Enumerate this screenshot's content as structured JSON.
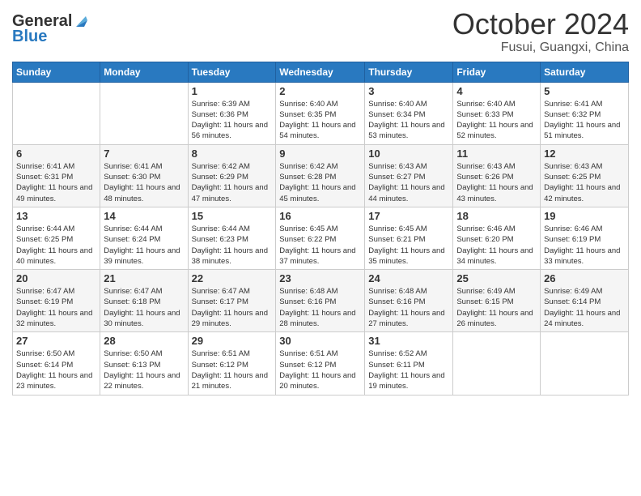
{
  "header": {
    "logo": {
      "general": "General",
      "blue": "Blue"
    },
    "title": "October 2024",
    "location": "Fusui, Guangxi, China"
  },
  "weekdays": [
    "Sunday",
    "Monday",
    "Tuesday",
    "Wednesday",
    "Thursday",
    "Friday",
    "Saturday"
  ],
  "weeks": [
    [
      {
        "day": "",
        "sunrise": "",
        "sunset": "",
        "daylight": ""
      },
      {
        "day": "",
        "sunrise": "",
        "sunset": "",
        "daylight": ""
      },
      {
        "day": "1",
        "sunrise": "Sunrise: 6:39 AM",
        "sunset": "Sunset: 6:36 PM",
        "daylight": "Daylight: 11 hours and 56 minutes."
      },
      {
        "day": "2",
        "sunrise": "Sunrise: 6:40 AM",
        "sunset": "Sunset: 6:35 PM",
        "daylight": "Daylight: 11 hours and 54 minutes."
      },
      {
        "day": "3",
        "sunrise": "Sunrise: 6:40 AM",
        "sunset": "Sunset: 6:34 PM",
        "daylight": "Daylight: 11 hours and 53 minutes."
      },
      {
        "day": "4",
        "sunrise": "Sunrise: 6:40 AM",
        "sunset": "Sunset: 6:33 PM",
        "daylight": "Daylight: 11 hours and 52 minutes."
      },
      {
        "day": "5",
        "sunrise": "Sunrise: 6:41 AM",
        "sunset": "Sunset: 6:32 PM",
        "daylight": "Daylight: 11 hours and 51 minutes."
      }
    ],
    [
      {
        "day": "6",
        "sunrise": "Sunrise: 6:41 AM",
        "sunset": "Sunset: 6:31 PM",
        "daylight": "Daylight: 11 hours and 49 minutes."
      },
      {
        "day": "7",
        "sunrise": "Sunrise: 6:41 AM",
        "sunset": "Sunset: 6:30 PM",
        "daylight": "Daylight: 11 hours and 48 minutes."
      },
      {
        "day": "8",
        "sunrise": "Sunrise: 6:42 AM",
        "sunset": "Sunset: 6:29 PM",
        "daylight": "Daylight: 11 hours and 47 minutes."
      },
      {
        "day": "9",
        "sunrise": "Sunrise: 6:42 AM",
        "sunset": "Sunset: 6:28 PM",
        "daylight": "Daylight: 11 hours and 45 minutes."
      },
      {
        "day": "10",
        "sunrise": "Sunrise: 6:43 AM",
        "sunset": "Sunset: 6:27 PM",
        "daylight": "Daylight: 11 hours and 44 minutes."
      },
      {
        "day": "11",
        "sunrise": "Sunrise: 6:43 AM",
        "sunset": "Sunset: 6:26 PM",
        "daylight": "Daylight: 11 hours and 43 minutes."
      },
      {
        "day": "12",
        "sunrise": "Sunrise: 6:43 AM",
        "sunset": "Sunset: 6:25 PM",
        "daylight": "Daylight: 11 hours and 42 minutes."
      }
    ],
    [
      {
        "day": "13",
        "sunrise": "Sunrise: 6:44 AM",
        "sunset": "Sunset: 6:25 PM",
        "daylight": "Daylight: 11 hours and 40 minutes."
      },
      {
        "day": "14",
        "sunrise": "Sunrise: 6:44 AM",
        "sunset": "Sunset: 6:24 PM",
        "daylight": "Daylight: 11 hours and 39 minutes."
      },
      {
        "day": "15",
        "sunrise": "Sunrise: 6:44 AM",
        "sunset": "Sunset: 6:23 PM",
        "daylight": "Daylight: 11 hours and 38 minutes."
      },
      {
        "day": "16",
        "sunrise": "Sunrise: 6:45 AM",
        "sunset": "Sunset: 6:22 PM",
        "daylight": "Daylight: 11 hours and 37 minutes."
      },
      {
        "day": "17",
        "sunrise": "Sunrise: 6:45 AM",
        "sunset": "Sunset: 6:21 PM",
        "daylight": "Daylight: 11 hours and 35 minutes."
      },
      {
        "day": "18",
        "sunrise": "Sunrise: 6:46 AM",
        "sunset": "Sunset: 6:20 PM",
        "daylight": "Daylight: 11 hours and 34 minutes."
      },
      {
        "day": "19",
        "sunrise": "Sunrise: 6:46 AM",
        "sunset": "Sunset: 6:19 PM",
        "daylight": "Daylight: 11 hours and 33 minutes."
      }
    ],
    [
      {
        "day": "20",
        "sunrise": "Sunrise: 6:47 AM",
        "sunset": "Sunset: 6:19 PM",
        "daylight": "Daylight: 11 hours and 32 minutes."
      },
      {
        "day": "21",
        "sunrise": "Sunrise: 6:47 AM",
        "sunset": "Sunset: 6:18 PM",
        "daylight": "Daylight: 11 hours and 30 minutes."
      },
      {
        "day": "22",
        "sunrise": "Sunrise: 6:47 AM",
        "sunset": "Sunset: 6:17 PM",
        "daylight": "Daylight: 11 hours and 29 minutes."
      },
      {
        "day": "23",
        "sunrise": "Sunrise: 6:48 AM",
        "sunset": "Sunset: 6:16 PM",
        "daylight": "Daylight: 11 hours and 28 minutes."
      },
      {
        "day": "24",
        "sunrise": "Sunrise: 6:48 AM",
        "sunset": "Sunset: 6:16 PM",
        "daylight": "Daylight: 11 hours and 27 minutes."
      },
      {
        "day": "25",
        "sunrise": "Sunrise: 6:49 AM",
        "sunset": "Sunset: 6:15 PM",
        "daylight": "Daylight: 11 hours and 26 minutes."
      },
      {
        "day": "26",
        "sunrise": "Sunrise: 6:49 AM",
        "sunset": "Sunset: 6:14 PM",
        "daylight": "Daylight: 11 hours and 24 minutes."
      }
    ],
    [
      {
        "day": "27",
        "sunrise": "Sunrise: 6:50 AM",
        "sunset": "Sunset: 6:14 PM",
        "daylight": "Daylight: 11 hours and 23 minutes."
      },
      {
        "day": "28",
        "sunrise": "Sunrise: 6:50 AM",
        "sunset": "Sunset: 6:13 PM",
        "daylight": "Daylight: 11 hours and 22 minutes."
      },
      {
        "day": "29",
        "sunrise": "Sunrise: 6:51 AM",
        "sunset": "Sunset: 6:12 PM",
        "daylight": "Daylight: 11 hours and 21 minutes."
      },
      {
        "day": "30",
        "sunrise": "Sunrise: 6:51 AM",
        "sunset": "Sunset: 6:12 PM",
        "daylight": "Daylight: 11 hours and 20 minutes."
      },
      {
        "day": "31",
        "sunrise": "Sunrise: 6:52 AM",
        "sunset": "Sunset: 6:11 PM",
        "daylight": "Daylight: 11 hours and 19 minutes."
      },
      {
        "day": "",
        "sunrise": "",
        "sunset": "",
        "daylight": ""
      },
      {
        "day": "",
        "sunrise": "",
        "sunset": "",
        "daylight": ""
      }
    ]
  ]
}
